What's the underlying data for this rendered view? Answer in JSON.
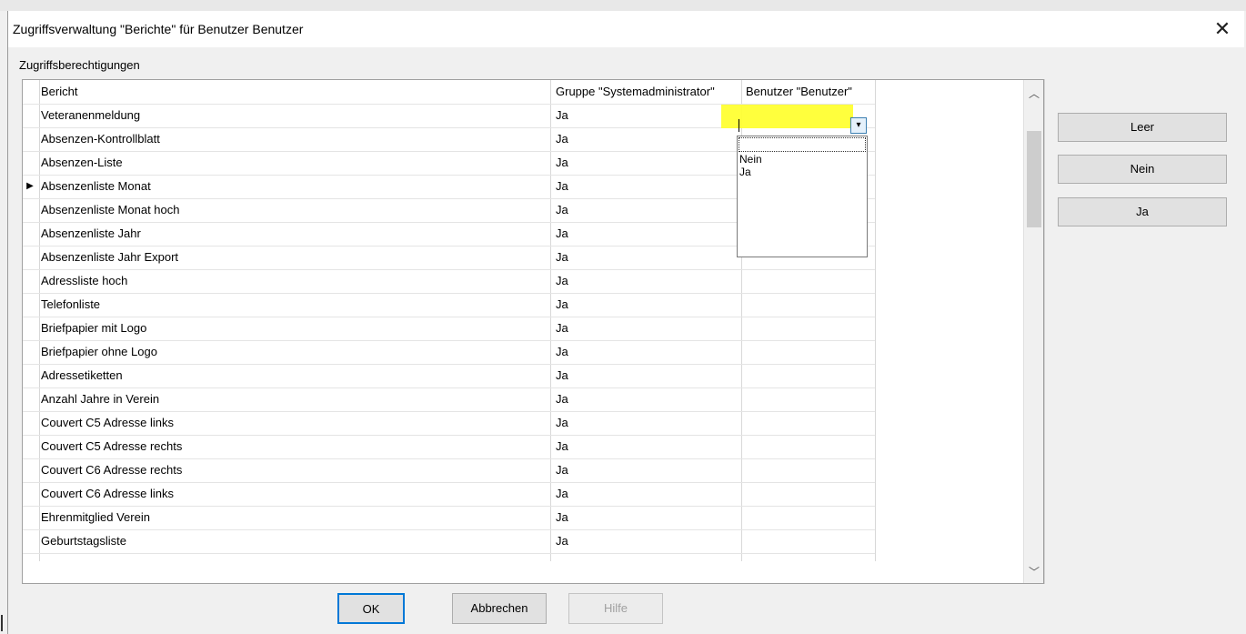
{
  "window": {
    "title": "Zugriffsverwaltung \"Berichte\" für Benutzer Benutzer",
    "close_icon": "close-icon"
  },
  "group_label": "Zugriffsberechtigungen",
  "grid": {
    "columns": [
      "Bericht",
      "Gruppe \"Systemadministrator\"",
      "Benutzer \"Benutzer\""
    ],
    "current_row_index": 3,
    "rows": [
      {
        "name": "Veteranenmeldung",
        "group": "Ja",
        "user": ""
      },
      {
        "name": "Absenzen-Kontrollblatt",
        "group": "Ja",
        "user": ""
      },
      {
        "name": "Absenzen-Liste",
        "group": "Ja",
        "user": ""
      },
      {
        "name": "Absenzenliste Monat",
        "group": "Ja",
        "user": ""
      },
      {
        "name": "Absenzenliste Monat hoch",
        "group": "Ja",
        "user": ""
      },
      {
        "name": "Absenzenliste Jahr",
        "group": "Ja",
        "user": ""
      },
      {
        "name": "Absenzenliste Jahr Export",
        "group": "Ja",
        "user": ""
      },
      {
        "name": "Adressliste hoch",
        "group": "Ja",
        "user": ""
      },
      {
        "name": "Telefonliste",
        "group": "Ja",
        "user": ""
      },
      {
        "name": "Briefpapier mit Logo",
        "group": "Ja",
        "user": ""
      },
      {
        "name": "Briefpapier ohne Logo",
        "group": "Ja",
        "user": ""
      },
      {
        "name": "Adressetiketten",
        "group": "Ja",
        "user": ""
      },
      {
        "name": "Anzahl Jahre in Verein",
        "group": "Ja",
        "user": ""
      },
      {
        "name": "Couvert C5 Adresse links",
        "group": "Ja",
        "user": ""
      },
      {
        "name": "Couvert C5 Adresse rechts",
        "group": "Ja",
        "user": ""
      },
      {
        "name": "Couvert C6 Adresse rechts",
        "group": "Ja",
        "user": ""
      },
      {
        "name": "Couvert C6 Adresse links",
        "group": "Ja",
        "user": ""
      },
      {
        "name": "Ehrenmitglied Verein",
        "group": "Ja",
        "user": ""
      },
      {
        "name": "Geburtstagsliste",
        "group": "Ja",
        "user": ""
      }
    ]
  },
  "combo": {
    "value": "",
    "options": [
      "",
      "Nein",
      "Ja"
    ],
    "highlight_color": "#ffff33"
  },
  "side_buttons": {
    "leer": "Leer",
    "nein": "Nein",
    "ja": "Ja"
  },
  "buttons": {
    "ok": "OK",
    "cancel": "Abbrechen",
    "help": "Hilfe"
  },
  "colors": {
    "accent": "#0078d7"
  }
}
